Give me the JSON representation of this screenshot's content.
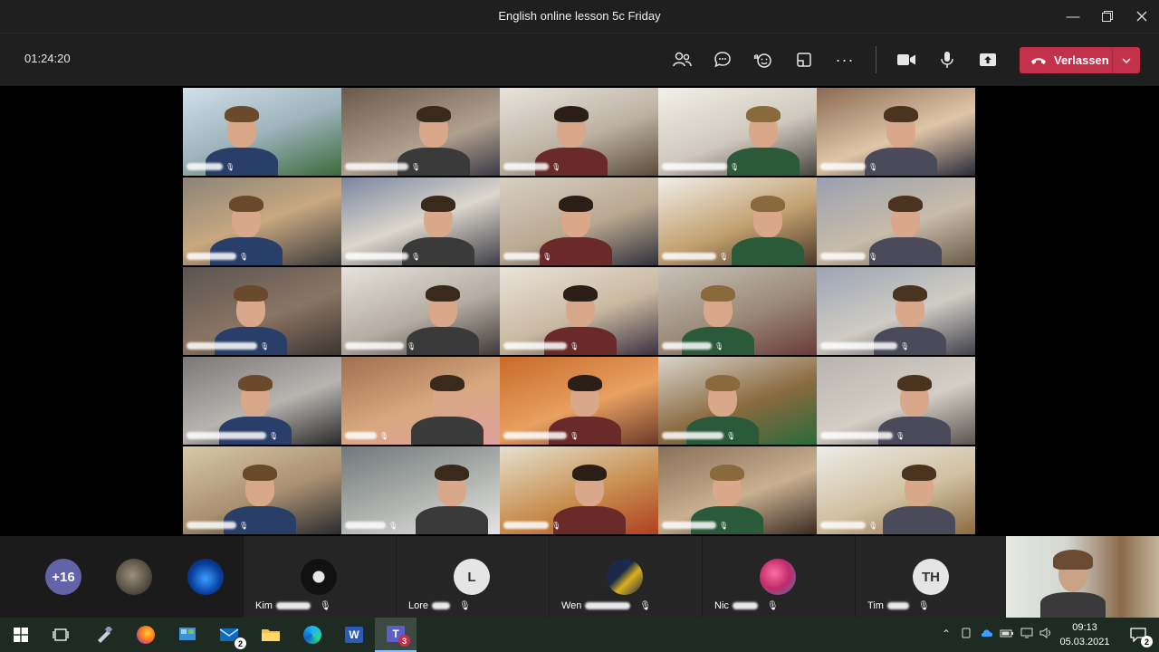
{
  "window": {
    "title": "English online lesson 5c Friday"
  },
  "toolbar": {
    "timer": "01:24:20",
    "leave_label": "Verlassen"
  },
  "overflow_count": "+16",
  "participants": [
    {
      "name_visible": "Kim",
      "kind": "avatar-photo-dark"
    },
    {
      "initial": "L",
      "name_visible": "Lore",
      "kind": "initial"
    },
    {
      "name_visible": "Wen",
      "kind": "avatar-photo-yellow"
    },
    {
      "name_visible": "Nic",
      "kind": "avatar-photo-pink"
    },
    {
      "initial": "TH",
      "name_visible": "Tim",
      "kind": "initial"
    }
  ],
  "taskbar": {
    "time": "09:13",
    "date": "05.03.2021",
    "mail_badge": "2",
    "teams_badge": "3",
    "notif_badge": "2"
  }
}
